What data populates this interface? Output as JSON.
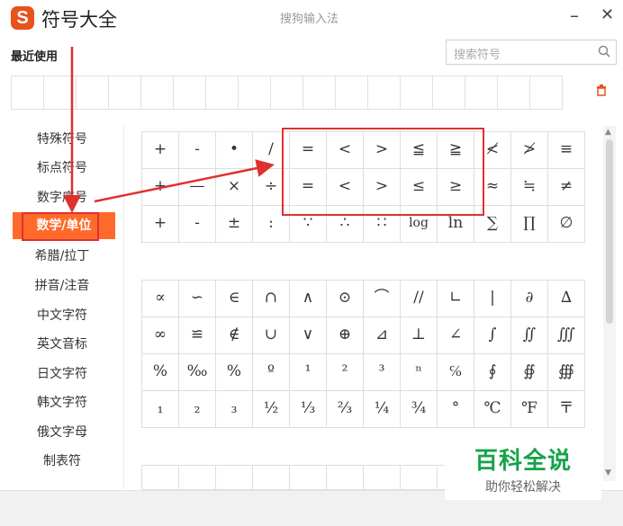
{
  "window": {
    "title": "符号大全",
    "ime_name": "搜狗输入法",
    "minimize": "–",
    "close": "✕",
    "logo": "S"
  },
  "recent_label": "最近使用",
  "search": {
    "placeholder": "搜索符号",
    "icon": "search-icon"
  },
  "trash_icon": "🗑",
  "sidebar": [
    {
      "label": "特殊符号"
    },
    {
      "label": "标点符号"
    },
    {
      "label": "数字序号"
    },
    {
      "label": "数学/单位",
      "active": true
    },
    {
      "label": "希腊/拉丁"
    },
    {
      "label": "拼音/注音"
    },
    {
      "label": "中文字符"
    },
    {
      "label": "英文音标"
    },
    {
      "label": "日文字符"
    },
    {
      "label": "韩文字符"
    },
    {
      "label": "俄文字母"
    },
    {
      "label": "制表符"
    }
  ],
  "symbols_top": [
    [
      "+",
      "-",
      "•",
      "/",
      "=",
      "<",
      ">",
      "≦",
      "≧",
      "≮",
      "≯",
      "≡"
    ],
    [
      "+",
      "—",
      "×",
      "÷",
      "=",
      "<",
      ">",
      "≤",
      "≥",
      "≈",
      "≒",
      "≠"
    ],
    [
      "+",
      "-",
      "±",
      ":",
      "∵",
      "∴",
      "∷",
      "log",
      "ln",
      "∑",
      "∏",
      "∅"
    ]
  ],
  "symbols_bottom": [
    [
      "∝",
      "∽",
      "∈",
      "∩",
      "∧",
      "⊙",
      "⌒",
      "//",
      "∟",
      "|",
      "∂",
      "∆"
    ],
    [
      "∞",
      "≌",
      "∉",
      "∪",
      "∨",
      "⊕",
      "⊿",
      "⊥",
      "∠",
      "∫",
      "∬",
      "∭"
    ],
    [
      "%",
      "‰",
      "%",
      "º",
      "¹",
      "²",
      "³",
      "ⁿ",
      "℅",
      "∮",
      "∯",
      "∰"
    ],
    [
      "₁",
      "₂",
      "₃",
      "½",
      "⅓",
      "⅔",
      "¼",
      "¾",
      "°",
      "℃",
      "℉",
      "〒"
    ]
  ],
  "watermark": {
    "main": "百科全说",
    "sub": "助你轻松解决"
  },
  "annotation_color": "#e0302e",
  "accent_color": "#ff6a2b"
}
